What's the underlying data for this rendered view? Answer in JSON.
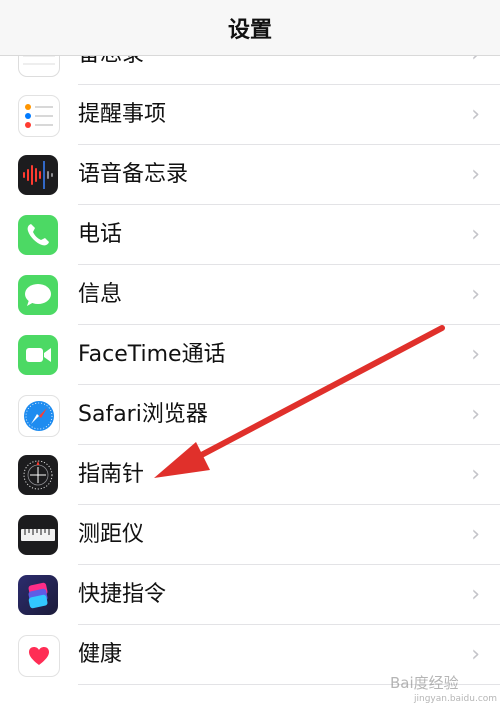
{
  "nav": {
    "title": "设置"
  },
  "rows": [
    {
      "label": "备忘录",
      "icon": "notes-icon"
    },
    {
      "label": "提醒事项",
      "icon": "reminders-icon"
    },
    {
      "label": "语音备忘录",
      "icon": "voice-memos-icon"
    },
    {
      "label": "电话",
      "icon": "phone-icon"
    },
    {
      "label": "信息",
      "icon": "messages-icon"
    },
    {
      "label": "FaceTime通话",
      "icon": "facetime-icon"
    },
    {
      "label": "Safari浏览器",
      "icon": "safari-icon"
    },
    {
      "label": "指南针",
      "icon": "compass-icon"
    },
    {
      "label": "测距仪",
      "icon": "measure-icon"
    },
    {
      "label": "快捷指令",
      "icon": "shortcuts-icon"
    },
    {
      "label": "健康",
      "icon": "health-icon"
    }
  ],
  "chevron": "›",
  "watermark": {
    "text": "Bai度经验",
    "sub": "jingyan.baidu.com"
  },
  "colors": {
    "arrow": "#e0302b",
    "phone": "#4cd964",
    "messages": "#4cd964",
    "facetime": "#4cd964",
    "health_heart": "#ff2d55"
  }
}
